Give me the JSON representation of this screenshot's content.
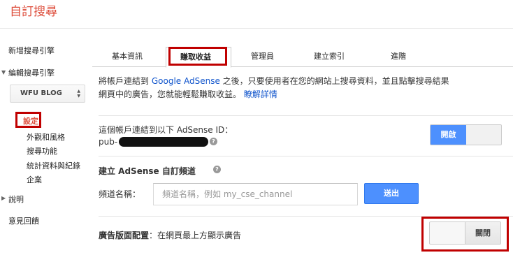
{
  "header": {
    "title": "自訂搜尋"
  },
  "sidebar": {
    "new_engine": "新增搜尋引擎",
    "edit_engine": "編輯搜尋引擎",
    "engine_select_value": "WFU BLOG",
    "settings": "設定",
    "sub_items": [
      "外觀和風格",
      "搜尋功能",
      "統計資料與紀錄",
      "企業"
    ],
    "help": "說明",
    "feedback": "意見回饋"
  },
  "tabs": [
    "基本資訊",
    "賺取收益",
    "管理員",
    "建立索引",
    "進階"
  ],
  "intro": {
    "text_1": "將帳戶連結到",
    "adsense_link": "Google AdSense",
    "text_2": "之後，只要使用者在您的網站上搜尋資料，並且點擊搜尋結果",
    "text_3": "網頁中的廣告，您就能輕鬆賺取收益。",
    "learn_more": "瞭解詳情"
  },
  "account": {
    "label": "這個帳戶連結到以下 AdSense ID：",
    "id_prefix": "pub-",
    "toggle_label": "開啟"
  },
  "channel": {
    "heading": "建立 AdSense 自訂頻道",
    "name_label": "頻道名稱：",
    "placeholder": "頻道名稱，例如 my_cse_channel",
    "submit_label": "送出"
  },
  "ad_layout": {
    "label": "廣告版面配置",
    "desc": "：在網頁最上方顯示廣告",
    "toggle_label": "關閉"
  },
  "colors": {
    "accent_red": "#dd4b39",
    "highlight_red": "#c00000",
    "blue": "#4d90fe",
    "link": "#1155cc"
  }
}
